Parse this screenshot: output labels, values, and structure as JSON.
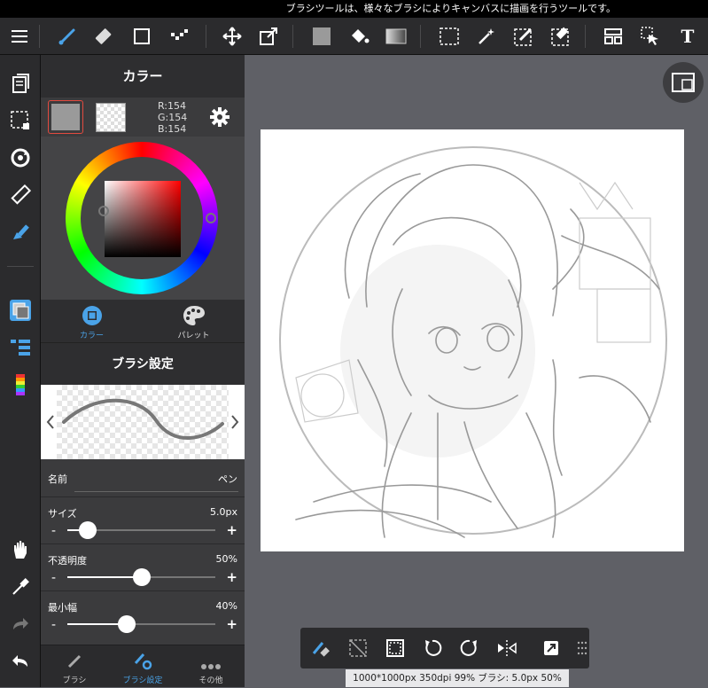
{
  "tooltip": "ブラシツールは、様々なブラシによりキャンバスに描画を行うツールです。",
  "toolbar": {
    "items": [
      "menu-icon",
      "brush-icon",
      "eraser-icon",
      "rectangle-icon",
      "dot-brush-icon",
      "move-icon",
      "transform-icon",
      "fill-color-icon",
      "bucket-icon",
      "gradient-icon",
      "select-icon",
      "magic-wand-icon",
      "select-pen-icon",
      "select-eraser-icon",
      "layout-icon",
      "select-arrow-icon",
      "text-icon"
    ],
    "text_tool_label": "T"
  },
  "panel": {
    "title": "カラー",
    "rgb": {
      "r": "R:154",
      "g": "G:154",
      "b": "B:154"
    },
    "current_color": "#9a9a9a",
    "tabs": [
      {
        "label": "カラー",
        "active": true
      },
      {
        "label": "パレット",
        "active": false
      }
    ]
  },
  "brush": {
    "title": "ブラシ設定",
    "name_label": "名前",
    "name_value": "ペン",
    "size_label": "サイズ",
    "size_value": "5.0px",
    "size_fraction": 0.14,
    "opacity_label": "不透明度",
    "opacity_value": "50%",
    "opacity_fraction": 0.5,
    "minwidth_label": "最小幅",
    "minwidth_value": "40%",
    "minwidth_fraction": 0.4,
    "minus": "-",
    "plus": "+"
  },
  "bottom_tabs": [
    {
      "label": "ブラシ",
      "active": false
    },
    {
      "label": "ブラシ設定",
      "active": true
    },
    {
      "label": "その他",
      "active": false
    }
  ],
  "status": "1000*1000px 350dpi 99% ブラシ: 5.0px 50%",
  "accent_color": "#4aa3e8"
}
